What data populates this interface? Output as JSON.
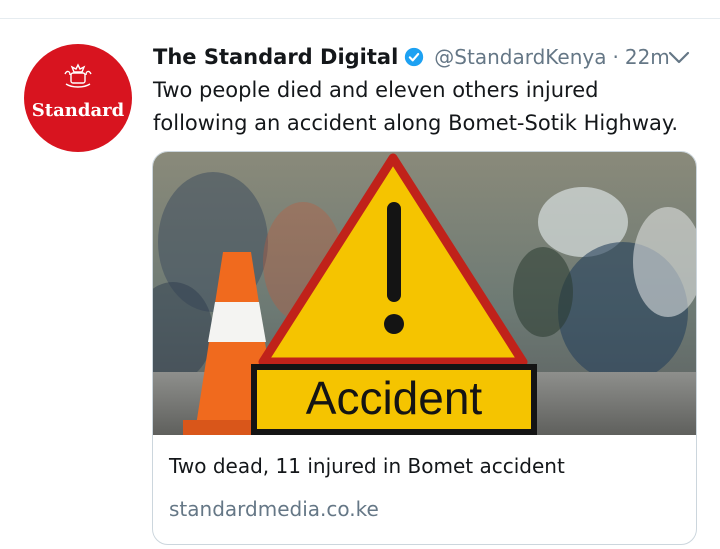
{
  "tweet": {
    "avatar_label": "Standard",
    "display_name": "The Standard Digital",
    "handle": "@StandardKenya",
    "separator": "·",
    "time": "22m",
    "text": "Two people died and eleven others injured following an accident along Bomet-Sotik Highway.",
    "verified_icon": "verified-badge-icon",
    "menu_icon": "chevron-down-icon"
  },
  "card": {
    "image_sign_text": "Accident",
    "title": "Two dead, 11 injured in Bomet accident",
    "domain": "standardmedia.co.ke"
  },
  "colors": {
    "brand_red": "#d8141f",
    "verified_blue": "#1da1f2",
    "secondary_text": "#657786",
    "sign_yellow": "#f5c400"
  }
}
